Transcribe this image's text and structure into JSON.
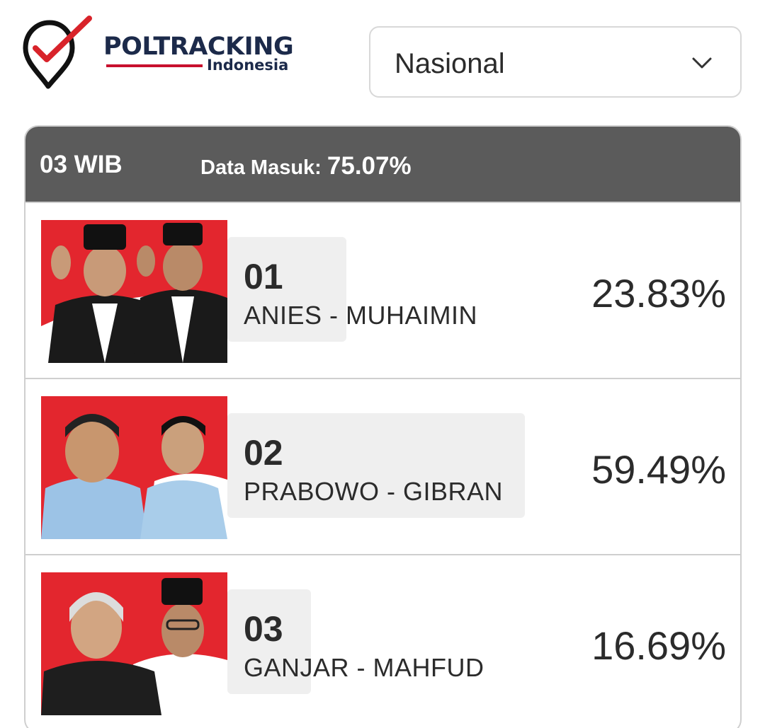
{
  "brand": {
    "name": "POLTRACKING",
    "sub": "Indonesia",
    "logo_icon": "check-pin-icon"
  },
  "region": {
    "selected": "Nasional",
    "icon": "chevron-down-icon"
  },
  "summary": {
    "time": "03 WIB",
    "data_label": "Data Masuk:",
    "data_value": "75.07%"
  },
  "candidates": [
    {
      "number": "01",
      "name": "ANIES - MUHAIMIN",
      "percent": "23.83%",
      "photo_bg": "#e3262e"
    },
    {
      "number": "02",
      "name": "PRABOWO - GIBRAN",
      "percent": "59.49%",
      "photo_bg": "#e3262e"
    },
    {
      "number": "03",
      "name": "GANJAR - MAHFUD",
      "percent": "16.69%",
      "photo_bg": "#e3262e"
    }
  ],
  "colors": {
    "accent_red": "#c8102e",
    "header_gray": "#5b5b5b",
    "brand_navy": "#1c2a4a"
  }
}
